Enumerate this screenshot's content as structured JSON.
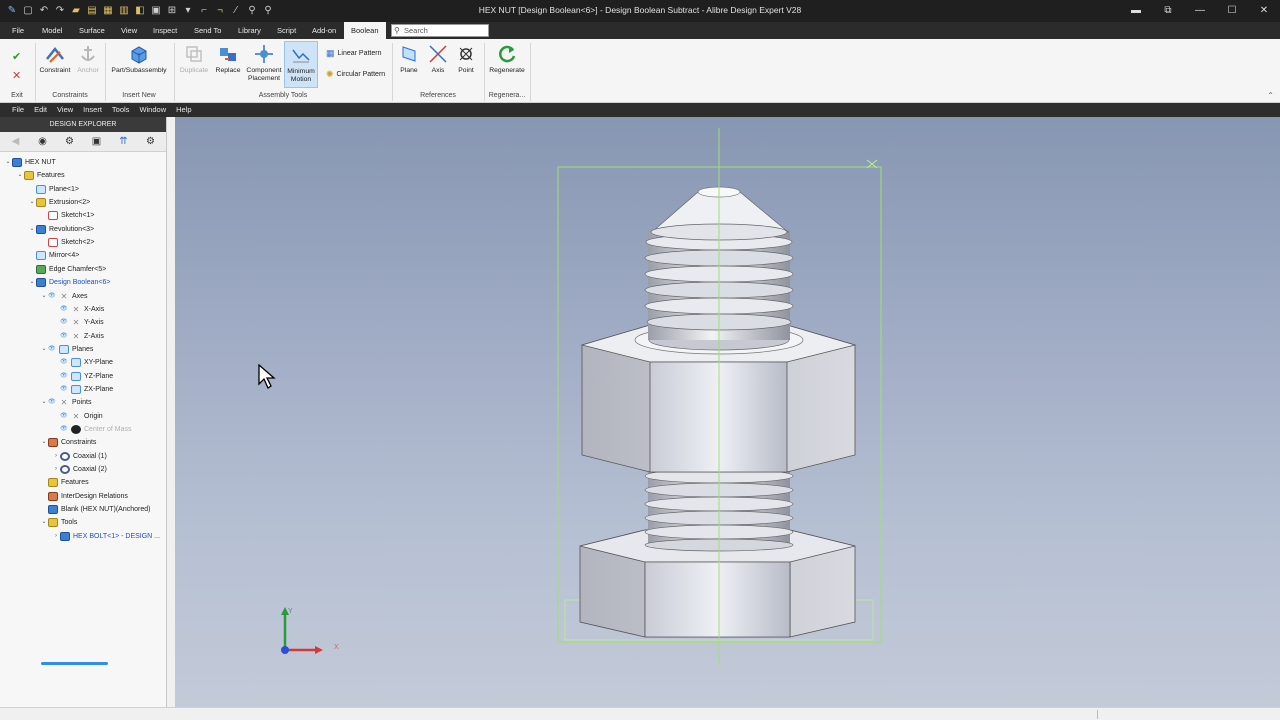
{
  "window": {
    "title": "HEX NUT [Design Boolean<6>] - Design Boolean Subtract - Alibre Design Expert V28"
  },
  "ribbon_tabs": [
    "File",
    "Model",
    "Surface",
    "View",
    "Inspect",
    "Send To",
    "Library",
    "Script",
    "Add-on",
    "Boolean"
  ],
  "active_tab": "Boolean",
  "search": {
    "placeholder": "Search"
  },
  "ribbon": {
    "exit_label": "Exit",
    "constraint": "Constraint",
    "anchor": "Anchor",
    "constraints_group": "Constraints",
    "part_subassembly": "Part/Subassembly",
    "insert_new_group": "Insert New",
    "duplicate": "Duplicate",
    "replace": "Replace",
    "component_placement": "Component Placement",
    "minimum_motion": "Minimum Motion",
    "linear_pattern": "Linear Pattern",
    "circular_pattern": "Circular Pattern",
    "assembly_tools_group": "Assembly Tools",
    "plane": "Plane",
    "axis": "Axis",
    "point": "Point",
    "references_group": "References",
    "regenerate": "Regenerate",
    "regenerate_group": "Regenera..."
  },
  "menu": [
    "File",
    "Edit",
    "View",
    "Insert",
    "Tools",
    "Window",
    "Help"
  ],
  "explorer": {
    "header": "DESIGN EXPLORER",
    "tree": [
      {
        "label": "HEX NUT",
        "icon": "blu",
        "level": 0,
        "tw": "v"
      },
      {
        "label": "Features",
        "icon": "yel",
        "level": 1,
        "tw": "v"
      },
      {
        "label": "Plane<1>",
        "icon": "pl",
        "level": 2,
        "tw": ""
      },
      {
        "label": "Extrusion<2>",
        "icon": "yel",
        "level": 2,
        "tw": "v"
      },
      {
        "label": "Sketch<1>",
        "icon": "sk",
        "level": 3,
        "tw": ""
      },
      {
        "label": "Revolution<3>",
        "icon": "blu",
        "level": 2,
        "tw": "v"
      },
      {
        "label": "Sketch<2>",
        "icon": "sk",
        "level": 3,
        "tw": ""
      },
      {
        "label": "Mirror<4>",
        "icon": "pl",
        "level": 2,
        "tw": ""
      },
      {
        "label": "Edge Chamfer<5>",
        "icon": "grn",
        "level": 2,
        "tw": ""
      },
      {
        "label": "Design Boolean<6>",
        "icon": "blu",
        "level": 2,
        "tw": "v",
        "style": "blue"
      },
      {
        "label": "Axes",
        "icon": "ax",
        "level": 3,
        "tw": "v",
        "eye": true
      },
      {
        "label": "X-Axis",
        "icon": "ax",
        "level": 4,
        "tw": "",
        "eye": true
      },
      {
        "label": "Y-Axis",
        "icon": "ax",
        "level": 4,
        "tw": "",
        "eye": true
      },
      {
        "label": "Z-Axis",
        "icon": "ax",
        "level": 4,
        "tw": "",
        "eye": true
      },
      {
        "label": "Planes",
        "icon": "pl",
        "level": 3,
        "tw": "v",
        "eye": true
      },
      {
        "label": "XY-Plane",
        "icon": "pl",
        "level": 4,
        "tw": "",
        "eye": true
      },
      {
        "label": "YZ-Plane",
        "icon": "pl",
        "level": 4,
        "tw": "",
        "eye": true
      },
      {
        "label": "ZX-Plane",
        "icon": "pl",
        "level": 4,
        "tw": "",
        "eye": true
      },
      {
        "label": "Points",
        "icon": "ax",
        "level": 3,
        "tw": "v",
        "eye": true
      },
      {
        "label": "Origin",
        "icon": "ax",
        "level": 4,
        "tw": "",
        "eye": true
      },
      {
        "label": "Center of Mass",
        "icon": "cm",
        "level": 4,
        "tw": "",
        "eye": true,
        "style": "gray"
      },
      {
        "label": "Constraints",
        "icon": "red",
        "level": 3,
        "tw": "v"
      },
      {
        "label": "Coaxial (1)",
        "icon": "ring",
        "level": 4,
        "tw": ">"
      },
      {
        "label": "Coaxial (2)",
        "icon": "ring",
        "level": 4,
        "tw": ">"
      },
      {
        "label": "Features",
        "icon": "yel",
        "level": 3,
        "tw": ""
      },
      {
        "label": "InterDesign Relations",
        "icon": "red",
        "level": 3,
        "tw": ""
      },
      {
        "label": "Blank (HEX NUT)(Anchored)",
        "icon": "blu",
        "level": 3,
        "tw": ""
      },
      {
        "label": "Tools",
        "icon": "yel",
        "level": 3,
        "tw": "v"
      },
      {
        "label": "HEX BOLT<1> - DESIGN ...",
        "icon": "blu",
        "level": 4,
        "tw": ">",
        "style": "blue"
      }
    ]
  },
  "triad": {
    "x_label": "X",
    "y_label": "Y"
  }
}
